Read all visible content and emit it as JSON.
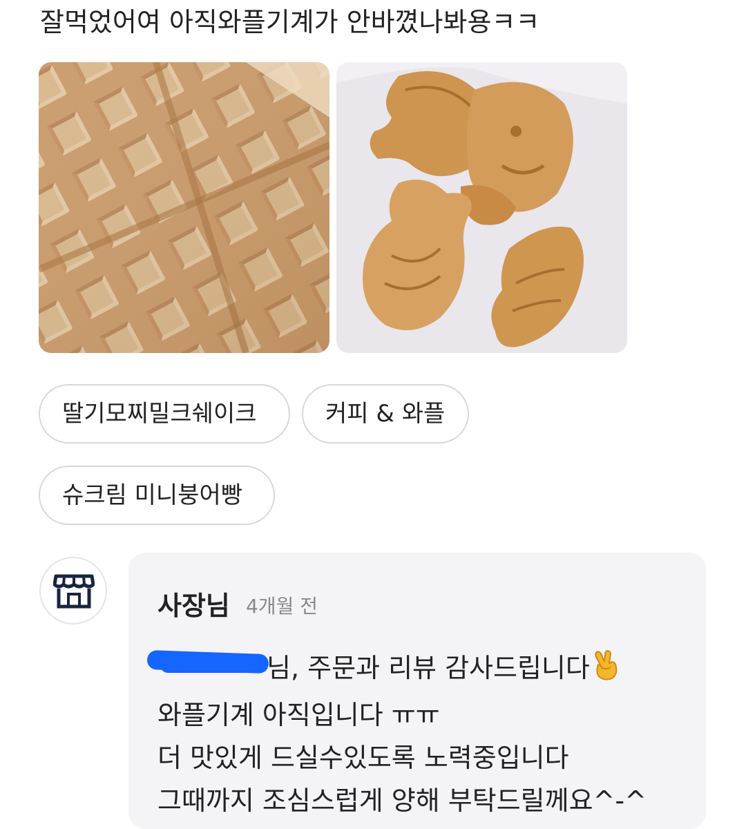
{
  "review": {
    "text": "잘먹었어여 아직와플기계가 안바꼈나봐용ㅋㅋ"
  },
  "photos": [
    {
      "name": "waffle-photo"
    },
    {
      "name": "bungeoppang-photo"
    }
  ],
  "menu_tags": [
    {
      "label": "딸기모찌밀크쉐이크"
    },
    {
      "label": "커피 & 와플"
    },
    {
      "label": "슈크림 미니붕어빵"
    }
  ],
  "owner_reply": {
    "icon": "store-icon",
    "author": "사장님",
    "time": "4개월 전",
    "line1_suffix": "님,  주문과 리뷰  감사드립니다",
    "line1_emoji": "crossed-fingers-icon",
    "line2": "와플기계 아직입니다 ㅠㅠ",
    "line3": "더 맛있게 드실수있도록 노력중입니다",
    "line4": "그때까지 조심스럽게 양해 부탁드릴께요^-^"
  },
  "colors": {
    "reply_background": "#f4f4f7",
    "redaction": "#1565ff",
    "chip_border": "#d8d8d8"
  }
}
